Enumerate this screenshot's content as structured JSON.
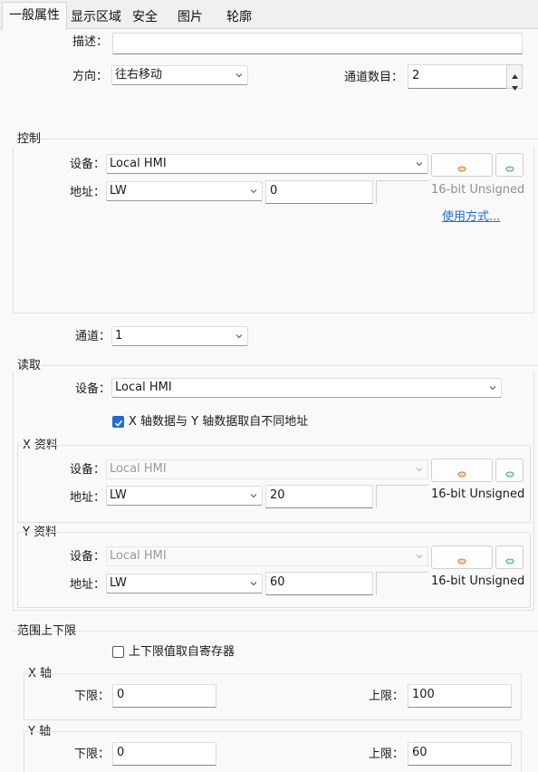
{
  "tabs": [
    "一般属性",
    "显示区域",
    "安全",
    "图片",
    "轮廓"
  ],
  "general": {
    "desc_label": "描述：",
    "desc_value": "",
    "direction_label": "方向：",
    "direction_value": "往右移动",
    "channel_count_label": "通道数目：",
    "channel_count_value": "2"
  },
  "control": {
    "title": "控制",
    "device_label": "设备：",
    "device_value": "Local HMI",
    "address_label": "地址：",
    "address_type": "LW",
    "address_value": "0",
    "data_type": "16-bit Unsigned",
    "usage_link": "使用方式..."
  },
  "channel": {
    "label": "通道：",
    "value": "1"
  },
  "read": {
    "title": "读取",
    "device_label": "设备：",
    "device_value": "Local HMI",
    "separate_checkbox_label": "X 轴数据与 Y 轴数据取自不同地址",
    "separate_checked": true,
    "x": {
      "title": "X 资料",
      "device_label": "设备：",
      "device_value": "Local HMI",
      "address_label": "地址：",
      "address_type": "LW",
      "address_value": "20",
      "data_type": "16-bit Unsigned"
    },
    "y": {
      "title": "Y 资料",
      "device_label": "设备：",
      "device_value": "Local HMI",
      "address_label": "地址：",
      "address_type": "LW",
      "address_value": "60",
      "data_type": "16-bit Unsigned"
    }
  },
  "range": {
    "title": "范围上下限",
    "register_checkbox_label": "上下限值取自寄存器",
    "register_checked": false,
    "x_axis": {
      "title": "X 轴",
      "low_label": "下限：",
      "low_value": "0",
      "high_label": "上限：",
      "high_value": "100"
    },
    "y_axis": {
      "title": "Y 轴",
      "low_label": "下限：",
      "low_value": "0",
      "high_label": "上限：",
      "high_value": "60"
    }
  },
  "colors": {
    "accent": "#1f6bd6",
    "link": "#1f6bd6",
    "background": "#f9f9f9"
  },
  "icons": [
    "chevron-down-icon",
    "refresh-icon",
    "settings-icon",
    "checkmark-icon",
    "spin-up-icon",
    "spin-down-icon"
  ]
}
